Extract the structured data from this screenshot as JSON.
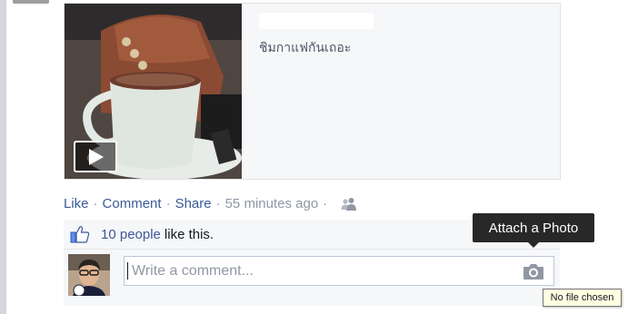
{
  "shared_link": {
    "caption": "ชิมกาแฟกันเถอะ"
  },
  "post_actions": {
    "like": "Like",
    "comment": "Comment",
    "share": "Share",
    "separator": "·",
    "timestamp": "55 minutes ago"
  },
  "likes": {
    "people": "10 people",
    "rest": "like this."
  },
  "comment_box": {
    "placeholder": "Write a comment..."
  },
  "tooltip": {
    "attach_photo": "Attach a Photo"
  },
  "file_input": {
    "status": "No file chosen"
  },
  "colors": {
    "link": "#3b5998",
    "meta": "#9197a3",
    "ufi_background": "#f6f7f9",
    "tooltip_background": "#282828"
  },
  "icons": [
    "play-icon",
    "friends-privacy-icon",
    "thumbs-up-icon",
    "camera-icon"
  ]
}
